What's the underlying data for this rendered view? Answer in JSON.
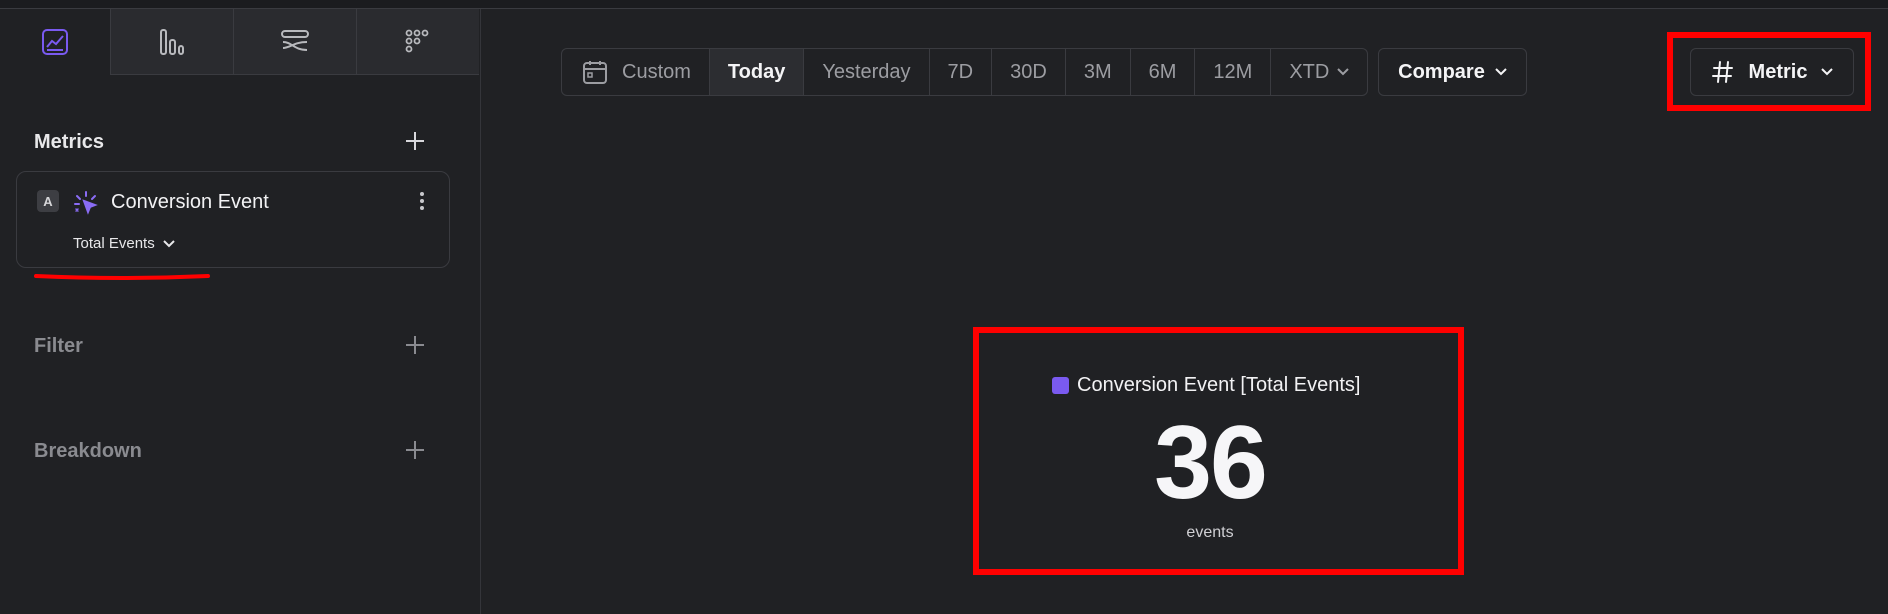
{
  "sidebar": {
    "tabs": [
      {
        "icon": "line-chart-icon",
        "active": true
      },
      {
        "icon": "bar-chart-icon",
        "active": false
      },
      {
        "icon": "flows-icon",
        "active": false
      },
      {
        "icon": "grid-dots-icon",
        "active": false
      }
    ],
    "metrics_title": "Metrics",
    "metric": {
      "letter": "A",
      "icon": "event-sparkle-icon",
      "name": "Conversion Event",
      "aggregation": "Total Events"
    },
    "filter_title": "Filter",
    "breakdown_title": "Breakdown"
  },
  "toolbar": {
    "custom_label": "Custom",
    "ranges": [
      "Today",
      "Yesterday",
      "7D",
      "30D",
      "3M",
      "6M",
      "12M"
    ],
    "active_range": "Today",
    "xtd_label": "XTD",
    "compare_label": "Compare",
    "metric_label": "Metric"
  },
  "display": {
    "legend": "Conversion Event [Total Events]",
    "value": "36",
    "unit": "events"
  },
  "colors": {
    "accent": "#7a5af0",
    "annotation_red": "#ff0000",
    "background": "#202124"
  }
}
